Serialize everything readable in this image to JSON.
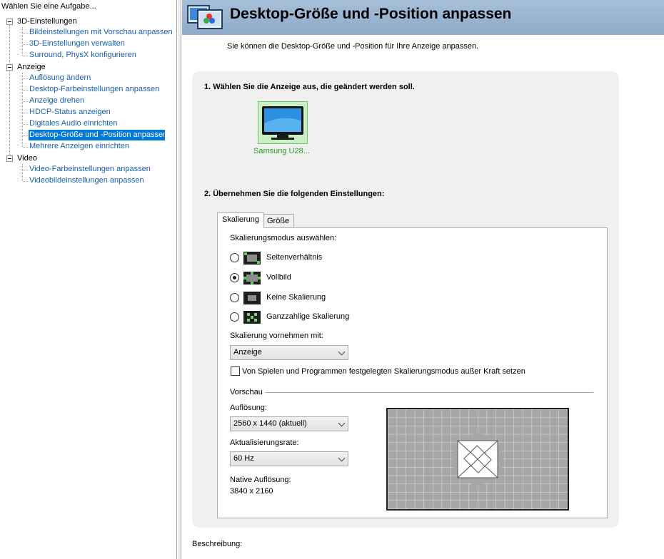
{
  "left_pane": {
    "header": "Wählen Sie eine Aufgabe...",
    "categories": [
      {
        "label": "3D-Einstellungen",
        "items": [
          "Bildeinstellungen mit Vorschau anpassen",
          "3D-Einstellungen verwalten",
          "Surround, PhysX konfigurieren"
        ]
      },
      {
        "label": "Anzeige",
        "items": [
          "Auflösung ändern",
          "Desktop-Farbeinstellungen anpassen",
          "Anzeige drehen",
          "HDCP-Status anzeigen",
          "Digitales Audio einrichten",
          "Desktop-Größe und -Position anpassen",
          "Mehrere Anzeigen einrichten"
        ]
      },
      {
        "label": "Video",
        "items": [
          "Video-Farbeinstellungen anpassen",
          "Videobildeinstellungen anpassen"
        ]
      }
    ],
    "selected_item": "Desktop-Größe und -Position anpassen"
  },
  "page": {
    "title": "Desktop-Größe und -Position anpassen",
    "description": "Sie können die Desktop-Größe und -Position für Ihre Anzeige anpassen.",
    "step1": "1. Wählen Sie die Anzeige aus, die geändert werden soll.",
    "display_name": "Samsung U28...",
    "step2": "2. Übernehmen Sie die folgenden Einstellungen:",
    "beschreibung": "Beschreibung:"
  },
  "tabs": {
    "skalierung": "Skalierung",
    "groesse": "Größe"
  },
  "scaling": {
    "mode_label": "Skalierungsmodus auswählen:",
    "modes": [
      {
        "label": "Seitenverhältnis",
        "checked": false
      },
      {
        "label": "Vollbild",
        "checked": true
      },
      {
        "label": "Keine Skalierung",
        "checked": false
      },
      {
        "label": "Ganzzahlige Skalierung",
        "checked": false
      }
    ],
    "perform_label": "Skalierung vornehmen mit:",
    "perform_value": "Anzeige",
    "override_label": "Von Spielen und Programmen festgelegten Skalierungsmodus außer Kraft setzen",
    "override_checked": false
  },
  "preview": {
    "group_label": "Vorschau",
    "resolution_label": "Auflösung:",
    "resolution_value": "2560 x 1440 (aktuell)",
    "refresh_label": "Aktualisierungsrate:",
    "refresh_value": "60 Hz",
    "native_label": "Native Auflösung:",
    "native_value": "3840 x 2160"
  },
  "colors": {
    "selection": "#0078d7",
    "link": "#1a5fb4",
    "banner": "#9db6d3",
    "display_text": "#20a020"
  }
}
